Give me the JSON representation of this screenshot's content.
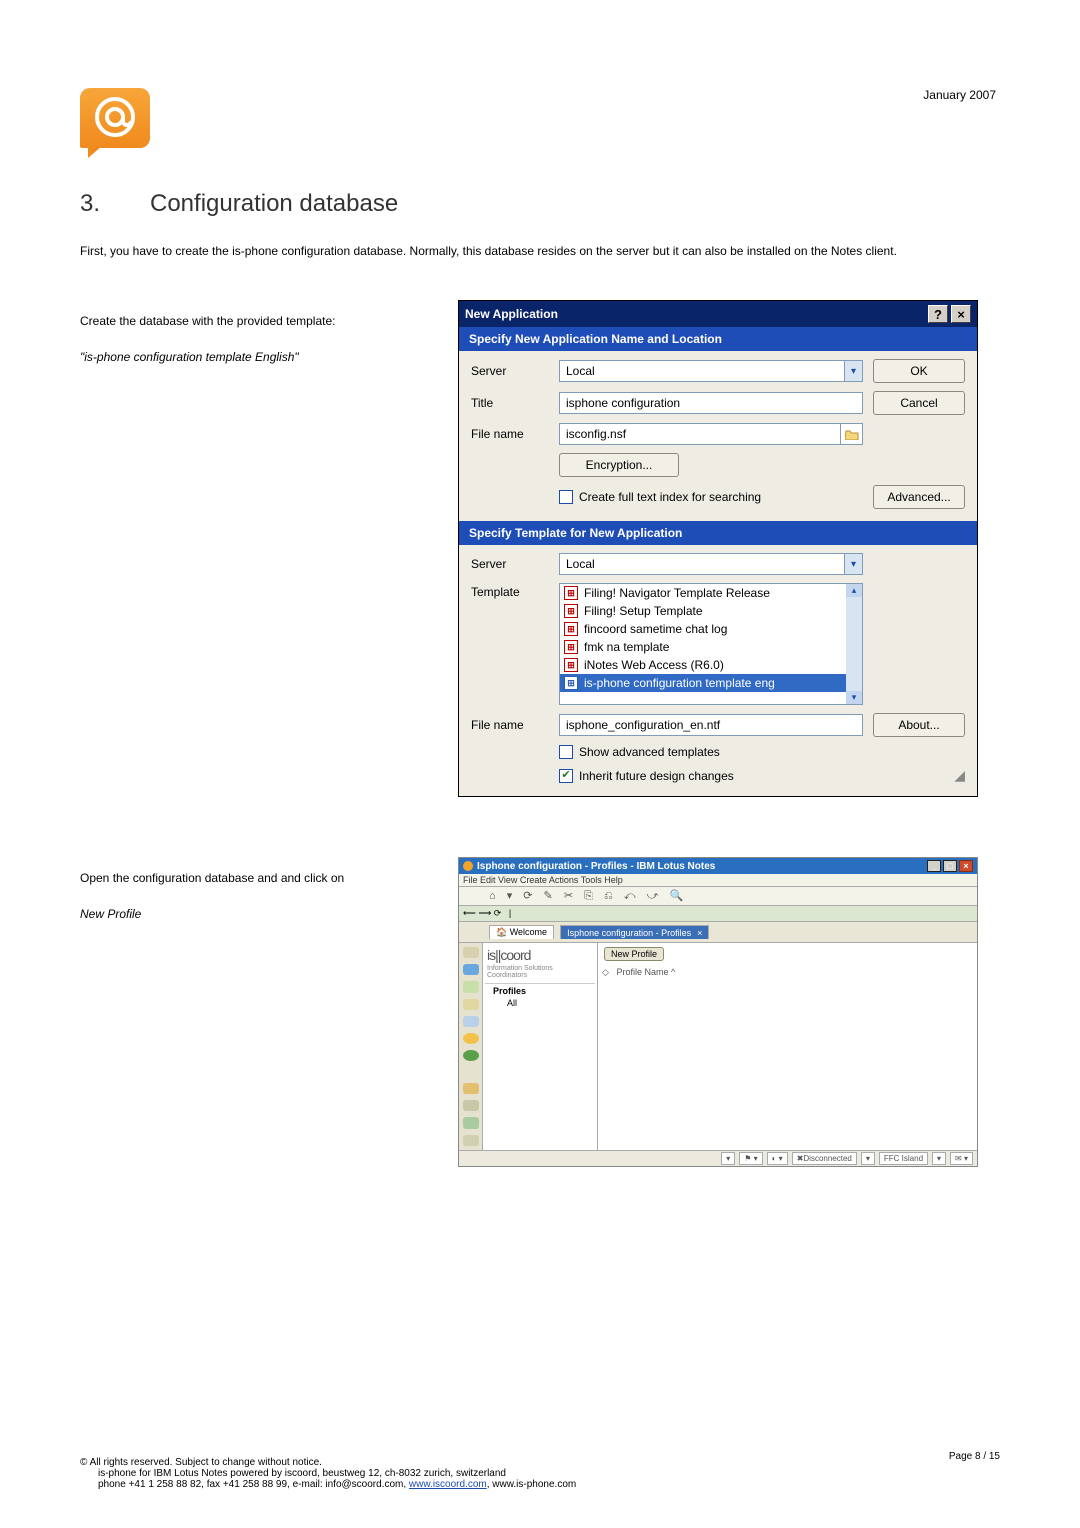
{
  "header": {
    "date": "January 2007"
  },
  "section": {
    "number": "3.",
    "title": "Configuration database"
  },
  "intro": "First, you have to create the is-phone configuration database. Normally, this database resides on the server but it can also be installed on the Notes client.",
  "create_text": "Create the database with the provided template:",
  "template_name": "\"is-phone configuration template English\"",
  "open_text": "Open the configuration database and and click on",
  "new_profile": "New Profile",
  "dialog": {
    "title": "New Application",
    "sec1": "Specify New Application Name and Location",
    "sec2": "Specify Template for New Application",
    "labels": {
      "server": "Server",
      "title": "Title",
      "filename": "File name",
      "template": "Template"
    },
    "fields": {
      "server1": "Local",
      "title": "isphone configuration",
      "filename1": "isconfig.nsf",
      "server2": "Local",
      "filename2": "isphone_configuration_en.ntf"
    },
    "buttons": {
      "ok": "OK",
      "cancel": "Cancel",
      "advanced": "Advanced...",
      "about": "About...",
      "encryption": "Encryption..."
    },
    "checks": {
      "fulltext": "Create full text index for searching",
      "show_adv": "Show advanced templates",
      "inherit": "Inherit future design changes"
    },
    "templates": [
      "Filing! Navigator Template Release",
      "Filing! Setup Template",
      "fincoord sametime chat log",
      "fmk na template",
      "iNotes Web Access (R6.0)",
      "is-phone configuration template eng"
    ]
  },
  "lotus": {
    "title": "Isphone configuration - Profiles - IBM Lotus Notes",
    "menu": "File   Edit   View   Create   Actions   Tools   Help",
    "tabs": {
      "welcome": "Welcome",
      "config": "Isphone configuration - Profiles"
    },
    "brand": "is||coord",
    "brand_sub": "Information Solutions Coordinators",
    "new_profile_btn": "New Profile",
    "col_header": "Profile Name  ^",
    "side": {
      "profiles": "Profiles",
      "all": "All"
    },
    "status": {
      "disconnected": "Disconnected",
      "island": "FFC Island"
    }
  },
  "footer": {
    "copyright": "©   All rights reserved. Subject to change without notice.",
    "line2": "is-phone for IBM Lotus Notes powered by iscoord, beustweg 12, ch-8032 zurich, switzerland",
    "line3a": "phone +41 1 258 88 82, fax +41 258 88 99, e-mail: info@scoord.com, ",
    "link": "www.iscoord.com",
    "line3b": ", www.is-phone.com",
    "page": "Page  8 /  15"
  },
  "chart_data": null
}
